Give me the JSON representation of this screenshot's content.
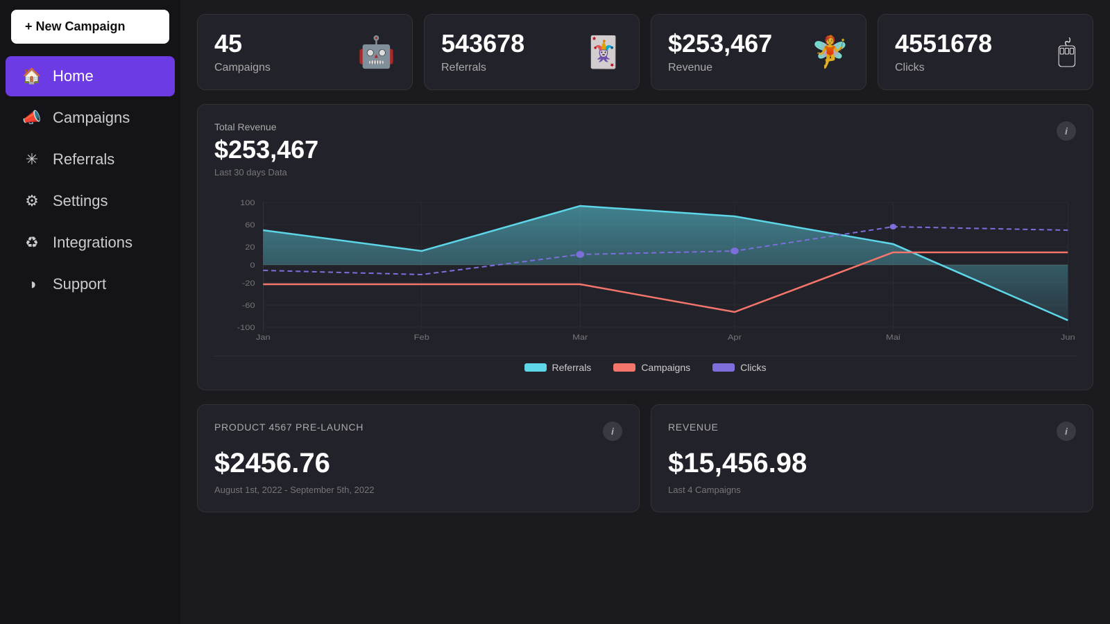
{
  "sidebar": {
    "new_campaign_label": "+ New Campaign",
    "items": [
      {
        "id": "home",
        "label": "Home",
        "icon": "🏠",
        "active": true
      },
      {
        "id": "campaigns",
        "label": "Campaigns",
        "icon": "📣",
        "active": false
      },
      {
        "id": "referrals",
        "label": "Referrals",
        "icon": "✳",
        "active": false
      },
      {
        "id": "settings",
        "label": "Settings",
        "icon": "⚙",
        "active": false
      },
      {
        "id": "integrations",
        "label": "Integrations",
        "icon": "♻",
        "active": false
      },
      {
        "id": "support",
        "label": "Support",
        "icon": "◑",
        "active": false
      }
    ]
  },
  "stat_cards": [
    {
      "value": "45",
      "label": "Campaigns",
      "icon": "🤖"
    },
    {
      "value": "543678",
      "label": "Referrals",
      "icon": "🃏"
    },
    {
      "value": "$253,467",
      "label": "Revenue",
      "icon": "🧚"
    },
    {
      "value": "4551678",
      "label": "Clicks",
      "icon": "🖱"
    }
  ],
  "chart": {
    "title": "Total Revenue",
    "value": "$253,467",
    "subtitle": "Last 30 days Data",
    "info_label": "i",
    "legend": [
      {
        "label": "Referrals",
        "color": "#5dd6e8"
      },
      {
        "label": "Campaigns",
        "color": "#f4756b"
      },
      {
        "label": "Clicks",
        "color": "#7c6edb"
      }
    ],
    "x_labels": [
      "Jan",
      "Feb",
      "Mar",
      "Apr",
      "Mai",
      "Jun"
    ],
    "y_labels": [
      "100",
      "60",
      "20",
      "0",
      "-20",
      "-60",
      "-100"
    ]
  },
  "bottom_cards": [
    {
      "title": "Product 4567 Pre-Launch",
      "value": "$2456.76",
      "subtitle": "August 1st, 2022 - September 5th, 2022"
    },
    {
      "title": "REVENUE",
      "value": "$15,456.98",
      "subtitle": "Last 4 Campaigns"
    }
  ]
}
